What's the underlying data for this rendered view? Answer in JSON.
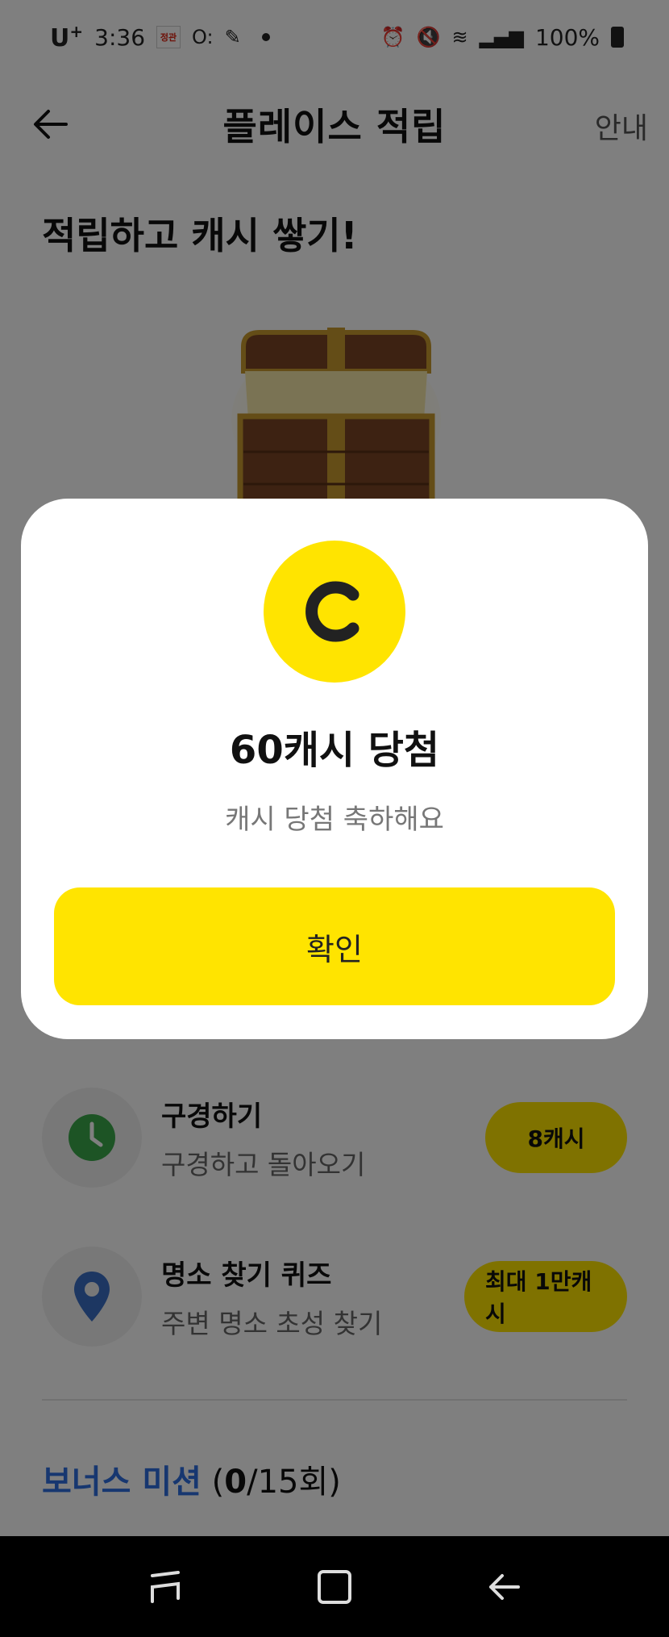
{
  "status_bar": {
    "carrier": "U",
    "carrier_sup": "+",
    "time": "3:36",
    "mini_icon_text": "정관",
    "battery": "100%"
  },
  "header": {
    "title": "플레이스 적립",
    "guide_label": "안내"
  },
  "main": {
    "heading": "적립하고 캐시 쌓기!"
  },
  "missions": [
    {
      "title": "구경하기",
      "subtitle": "구경하고 돌아오기",
      "reward": "8캐시",
      "icon": "clock-icon"
    },
    {
      "title": "명소 찾기 퀴즈",
      "subtitle": "주변 명소 초성 찾기",
      "reward": "최대 1만캐시",
      "icon": "location-pin-icon"
    }
  ],
  "bonus": {
    "title": "보너스 미션",
    "count_open": " (",
    "count_done": "0",
    "count_rest": "/15회)"
  },
  "modal": {
    "coin_letter": "C",
    "title": "60캐시 당첨",
    "subtitle": "캐시 당첨 축하해요",
    "confirm_label": "확인"
  },
  "colors": {
    "accent_yellow": "#ffe400",
    "bonus_blue": "#2f6fe0",
    "clock_green": "#3aa84a",
    "pin_blue": "#3b6fc4"
  }
}
